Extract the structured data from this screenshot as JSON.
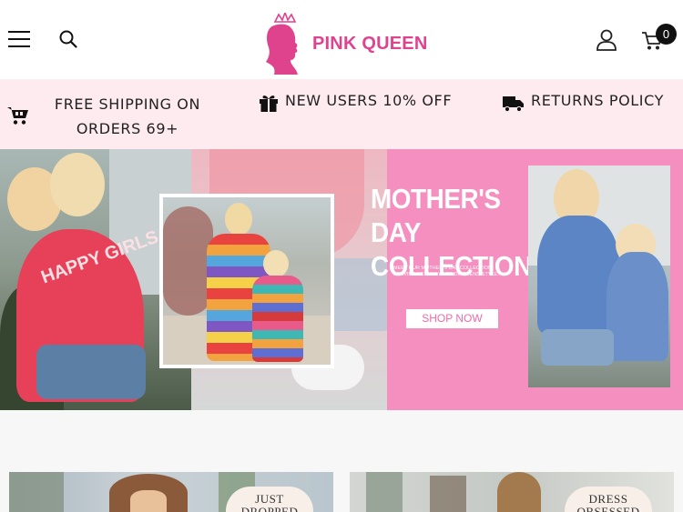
{
  "header": {
    "brand": "PINK QUEEN",
    "cart_count": "0",
    "icons": {
      "menu": "hamburger-menu-icon",
      "search": "search-icon",
      "account": "user-account-icon",
      "cart": "shopping-cart-icon"
    },
    "brand_color": "#e0438e"
  },
  "promo_bar": {
    "background": "#fdebef",
    "items": [
      {
        "icon": "cart-icon",
        "text": "FREE SHIPPING ON ORDERS 69+"
      },
      {
        "icon": "gift-icon",
        "text": "NEW USERS 10% OFF"
      },
      {
        "icon": "truck-icon",
        "text": "RETURNS POLICY"
      }
    ]
  },
  "hero": {
    "title": "MOTHER'S DAY COLLECTION",
    "subtitle_lines": [
      "MEET OUR MOTHER'S DAY COLLECTION",
      "SERVING NEW WAYS TO DO TREND STYLE."
    ],
    "cta_label": "SHOP NOW",
    "shirt_text": "HAPPY GIRLS",
    "accent_color": "#f48fbf"
  },
  "collections": [
    {
      "badge": "JUST DROPPED"
    },
    {
      "badge": "DRESS OBSESSED"
    }
  ]
}
